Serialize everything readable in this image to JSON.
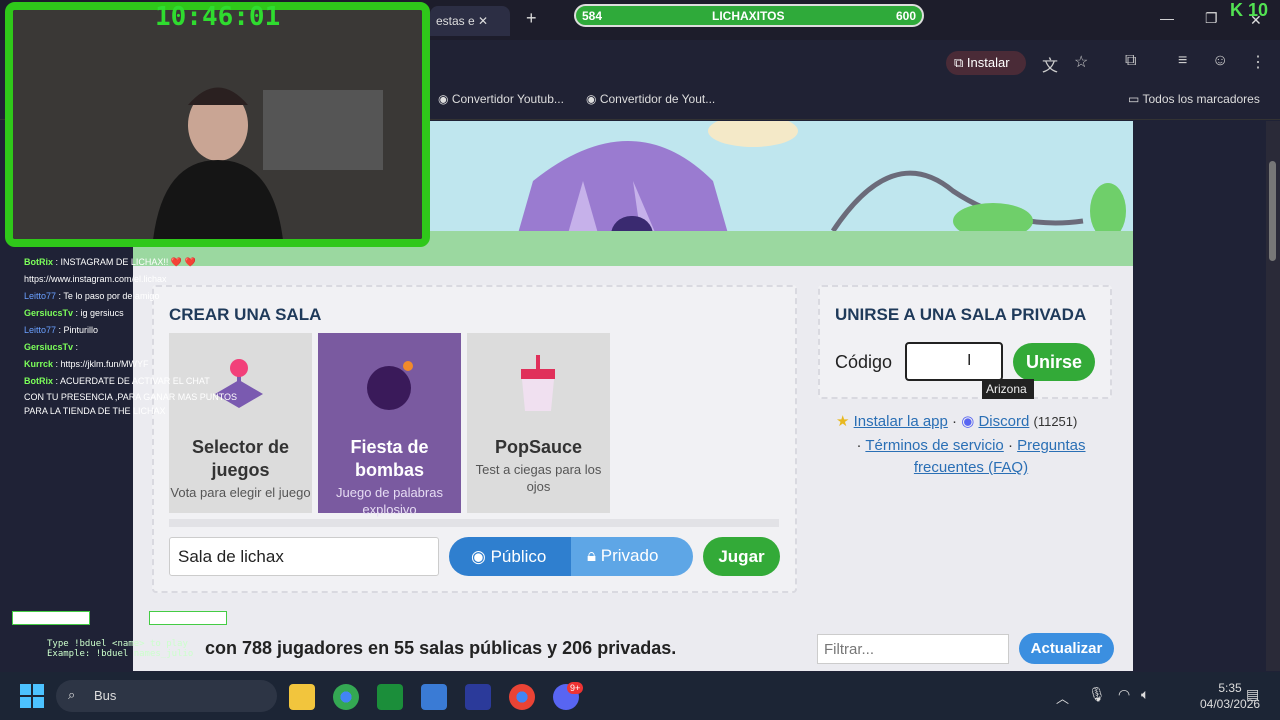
{
  "browser": {
    "tab_label": "estas e",
    "install_label": "Instalar",
    "bookmarks": [
      "Convertidor Youtub...",
      "Convertidor de Yout..."
    ],
    "all_bookmarks": "Todos los marcadores"
  },
  "stream": {
    "clock": "10:46:01",
    "xp_left": "584",
    "xp_title": "LICHAXITOS",
    "xp_right": "600",
    "kick_count": "10",
    "chat": [
      {
        "user": "BotRix",
        "text": ": INSTAGRAM DE LICHAX!! ❤️ ❤️"
      },
      {
        "user": "",
        "text": "https://www.instagram.com/el.lichax"
      },
      {
        "user": "Leitto77",
        "text": ": Te lo paso por de amigo"
      },
      {
        "user": "GersiucsTv",
        "text": ": ig gersiucs"
      },
      {
        "user": "Leitto77",
        "text": ": Pinturillo"
      },
      {
        "user": "GersiucsTv",
        "text": ":"
      },
      {
        "user": "Kurrck",
        "text": ": https://jklm.fun/MWYF"
      },
      {
        "user": "BotRix",
        "text": ": ACUERDATE DE ACTIVAR EL CHAT"
      },
      {
        "user": "",
        "text": "CON TU PRESENCIA ,PARA GANAR MAS PUNTOS"
      },
      {
        "user": "",
        "text": "PARA LA TIENDA DE THE LICHAX"
      }
    ],
    "command_hint1": "Type !bduel <name> to play",
    "command_hint2": "Example: !bduel names_julio"
  },
  "create": {
    "title": "CREAR UNA SALA",
    "cards": [
      {
        "title": "Selector de juegos",
        "desc": "Vota para elegir el juego"
      },
      {
        "title": "Fiesta de bombas",
        "desc": "Juego de palabras explosivo"
      },
      {
        "title": "PopSauce",
        "desc": "Test a ciegas para los ojos"
      }
    ],
    "room_name": "Sala de lichax",
    "public_label": "Público",
    "private_label": "Privado",
    "play_label": "Jugar"
  },
  "join": {
    "title": "UNIRSE A UNA SALA PRIVADA",
    "code_label": "Código",
    "join_label": "Unirse",
    "tooltip": "Arizona"
  },
  "links": {
    "install_app": "Instalar la app",
    "discord": "Discord",
    "discord_count": "(11251)",
    "terms": "Términos de servicio",
    "faq": "Preguntas frecuentes (FAQ)"
  },
  "status": {
    "text": "con 788 jugadores en 55 salas públicas y 206 privadas.",
    "filter_placeholder": "Filtrar...",
    "refresh_label": "Actualizar"
  },
  "taskbar": {
    "search": "Bus",
    "time": "5:35",
    "date": "04/03/2026",
    "discord_badge": "9+"
  },
  "colors": {
    "accent_green": "#33aa38",
    "accent_blue": "#2f7fcf",
    "bomb_purple": "#7a5aa0"
  }
}
